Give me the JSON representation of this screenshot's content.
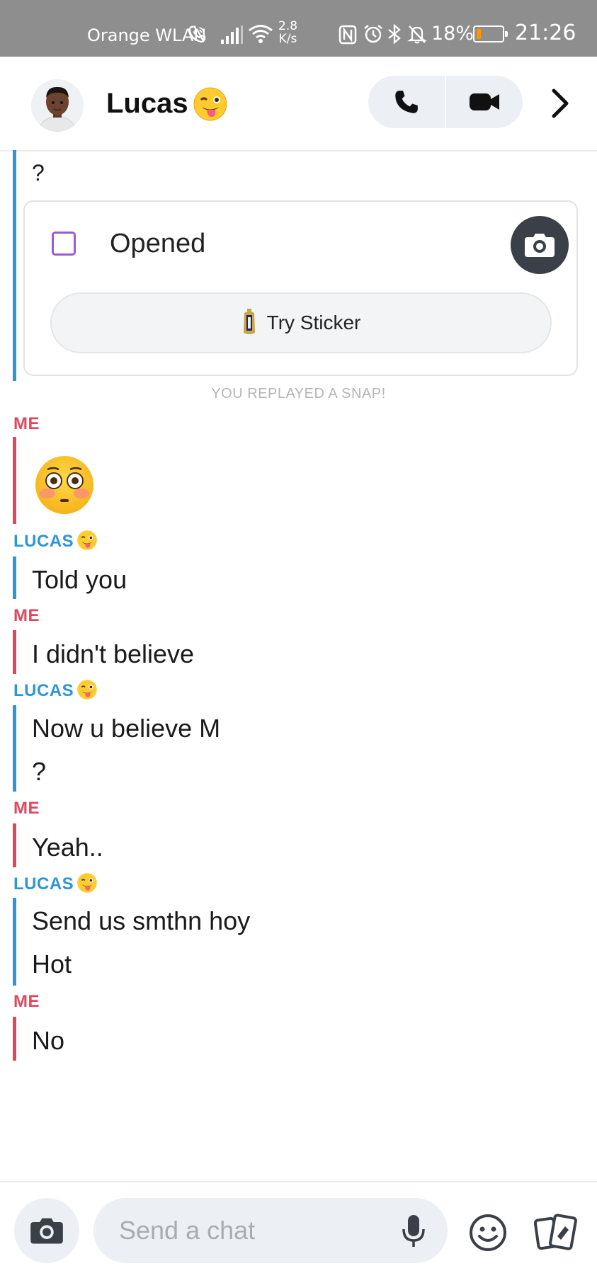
{
  "status_bar": {
    "carrier": "Orange WLAN",
    "speed_value": "2.8",
    "speed_unit": "K/s",
    "icons": [
      "wifi-call-icon",
      "signal-icon",
      "wifi-icon",
      "nfc-icon",
      "alarm-icon",
      "bluetooth-icon",
      "mute-icon"
    ],
    "battery_percent": "18%",
    "battery_level": 0.18,
    "time": "21:26"
  },
  "header": {
    "name": "Lucas",
    "name_emoji": "winking-tongue-emoji",
    "call_icon": "phone-icon",
    "video_icon": "video-camera-icon",
    "chevron_icon": "chevron-right-icon"
  },
  "chat": {
    "top_fragment": "?",
    "snap_card": {
      "status": "Opened",
      "sticker_button": "Try Sticker"
    },
    "system_note": "YOU REPLAYED A SNAP!",
    "groups": [
      {
        "sender": "ME",
        "messages": [
          "flushed-face-emoji"
        ]
      },
      {
        "sender": "LUCAS",
        "messages": [
          "Told you"
        ]
      },
      {
        "sender": "ME",
        "messages": [
          "I didn't believe"
        ]
      },
      {
        "sender": "LUCAS",
        "messages": [
          "Now u believe M",
          "?"
        ]
      },
      {
        "sender": "ME",
        "messages": [
          "Yeah.."
        ]
      },
      {
        "sender": "LUCAS",
        "messages": [
          "Send us smthn hoy",
          "Hot"
        ]
      },
      {
        "sender": "ME",
        "messages": [
          "No"
        ]
      }
    ]
  },
  "composer": {
    "placeholder": "Send a chat",
    "camera_icon": "camera-icon",
    "mic_icon": "microphone-icon",
    "emoji_icon": "smiley-icon",
    "cards_icon": "sticker-cards-icon"
  },
  "colors": {
    "me": "#e0475d",
    "lucas": "#2e95d6",
    "status_bar": "#8e8e8e"
  }
}
